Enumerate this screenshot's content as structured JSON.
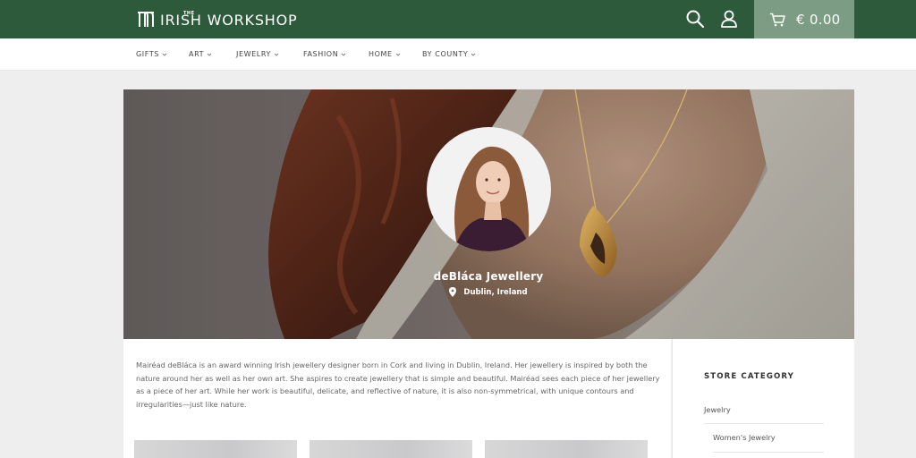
{
  "header": {
    "brand_small": "THE",
    "brand_name": "IRISH WORKSHOP",
    "search_icon": "search-icon",
    "account_icon": "user-icon",
    "cart_icon": "cart-icon",
    "cart_total": "€ 0.00",
    "colors": {
      "header_bg": "#2d5a3b",
      "cart_bg": "#7c9d84"
    }
  },
  "nav": {
    "items": [
      {
        "label": "GIFTS"
      },
      {
        "label": "ART"
      },
      {
        "label": "JEWELRY"
      },
      {
        "label": "FASHION"
      },
      {
        "label": "HOME"
      },
      {
        "label": "BY COUNTY"
      }
    ]
  },
  "store": {
    "name": "deBláca Jewellery",
    "location": "Dublin, Ireland",
    "location_icon": "map-pin-icon"
  },
  "bio": "Mairéad deBláca is an award winning Irish jewellery designer born in Cork and living in Dublin, Ireland. Her jewellery is inspired by both the nature around her as well as her own art. She aspires to create jewellery that is simple and beautiful. Mairéad sees each piece of her jewellery as a piece of her art. While her work is beautiful, delicate, and reflective of nature, it is also non-symmetrical, with unique contours and irregularities—just like nature.",
  "sidebar": {
    "title": "STORE CATEGORY",
    "categories": [
      {
        "label": "Jewelry"
      },
      {
        "label": "Women's Jewelry"
      }
    ]
  }
}
